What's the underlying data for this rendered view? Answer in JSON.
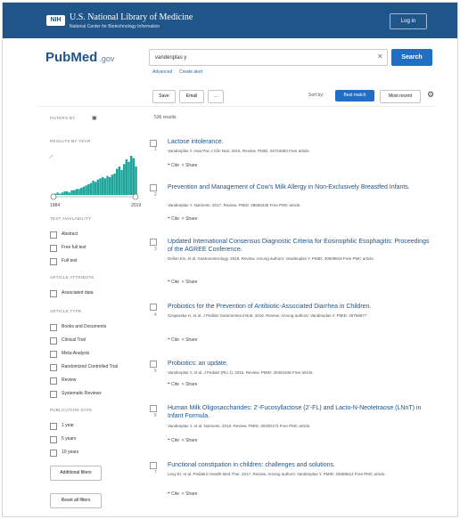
{
  "header": {
    "logo": "NIH",
    "title": "U.S. National Library of Medicine",
    "subtitle": "National Center for Biotechnology Information",
    "login": "Log in"
  },
  "search": {
    "logo_text": "PubMed",
    "logo_suffix": ".gov",
    "query": "vandenplas y",
    "clear_icon": "close-icon",
    "button": "Search",
    "advanced": "Advanced",
    "create_alert": "Create alert"
  },
  "toolbar": {
    "save": "Save",
    "email": "Email",
    "more": "...",
    "sort_by": "Sort by:",
    "best_match": "Best match",
    "most_recent": "Most recent",
    "settings_icon": "gear-icon"
  },
  "sidebar": {
    "filters_label": "FILTERS BY",
    "results_by_year": "RESULTS BY YEAR",
    "year_start": "1984",
    "year_end": "2019",
    "text_availability": "TEXT AVAILABILITY",
    "text_options": [
      "Abstract",
      "Free full text",
      "Full text"
    ],
    "article_attribute": "ARTICLE ATTRIBUTE",
    "attribute_options": [
      "Associated data"
    ],
    "article_type": "ARTICLE TYPE",
    "type_options": [
      "Books and Documents",
      "Clinical Trial",
      "Meta-Analysis",
      "Randomized Controlled Trial",
      "Review",
      "Systematic Reviews"
    ],
    "publication_date": "PUBLICATION DATE",
    "date_options": [
      "1 year",
      "5 years",
      "10 years"
    ],
    "additional_filters": "Additional filters",
    "reset_filters": "Reset all filters"
  },
  "results": {
    "count": "536 results",
    "cite": "Cite",
    "share": "Share",
    "items": [
      {
        "num": "1",
        "title": "Lactose intolerance.",
        "meta": "Vandenplas Y. Asia Pac J Clin Nutr. 2015. Review. PMID: 26715083 Free article."
      },
      {
        "num": "2",
        "title": "Prevention and Management of Cow's Milk Allergy in Non-Exclusively Breastfed Infants.",
        "meta": "Vandenplas Y. Nutrients. 2017. Review. PMID: 28696435 Free PMC article."
      },
      {
        "num": "3",
        "title": "Updated International Consensus Diagnostic Criteria for Eosinophilic Esophagitis: Proceedings of the AGREE Conference.",
        "meta": "Dellon ES, et al. Gastroenterology. 2018. Review. Among authors: Vandenplas Y. PMID: 30009819 Free PMC article."
      },
      {
        "num": "4",
        "title": "Probiotics for the Prevention of Antibiotic-Associated Diarrhea in Children.",
        "meta": "Szajewska H, et al. J Pediatr Gastroenterol Nutr. 2016. Review. Among authors: Vandenplas Y. PMID: 26756877"
      },
      {
        "num": "5",
        "title": "Probiotics: an update.",
        "meta": "Vandenplas Y, et al. J Pediatr (Rio J). 2015. Review. PMID: 25451848 Free article."
      },
      {
        "num": "6",
        "title": "Human Milk Oligosaccharides: 2'-Fucosyllactose (2'-FL) and Lacto-N-Neotetraose (LNnT) in Infant Formula.",
        "meta": "Vandenplas Y, et al. Nutrients. 2018. Review. PMID: 30200173 Free PMC article."
      },
      {
        "num": "7",
        "title": "Functional constipation in children: challenges and solutions.",
        "meta": "Levy EI, et al. Pediatric Health Med Ther. 2017. Review. Among authors: Vandenplas Y. PMID: 29388612 Free PMC article."
      }
    ]
  },
  "chart_data": {
    "type": "bar",
    "title": "RESULTS BY YEAR",
    "x_start": "1984",
    "x_end": "2019",
    "values": [
      1,
      1,
      2,
      1,
      2,
      3,
      3,
      2,
      4,
      4,
      5,
      5,
      6,
      7,
      8,
      9,
      10,
      12,
      11,
      13,
      14,
      15,
      14,
      16,
      15,
      17,
      18,
      22,
      24,
      21,
      26,
      30,
      28,
      33,
      31,
      24
    ],
    "color": "#1fa39a"
  },
  "colors": {
    "header_bg": "#20558a",
    "accent": "#1f6fc5",
    "link": "#20558a",
    "chart": "#1fa39a"
  }
}
